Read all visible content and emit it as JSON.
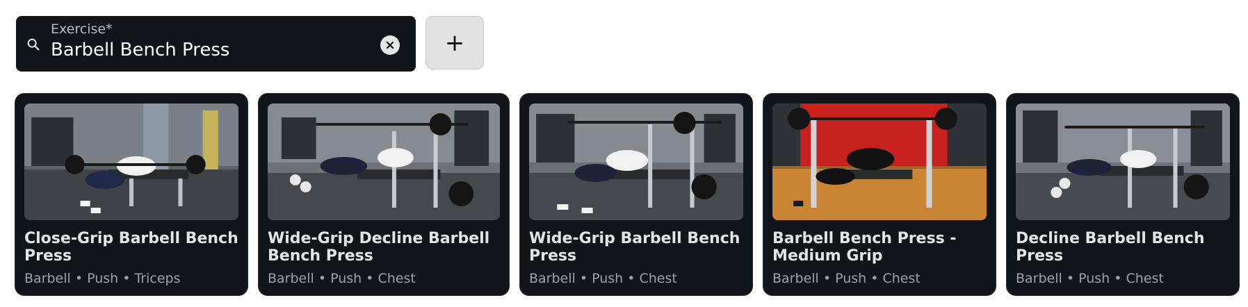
{
  "search": {
    "label": "Exercise*",
    "value": "Barbell Bench Press",
    "icon": "search-icon",
    "clear_icon": "clear-icon"
  },
  "add_button": {
    "label": "+"
  },
  "results": [
    {
      "title": "Close-Grip Barbell Bench Press",
      "meta": "Barbell • Push • Triceps",
      "image": "close-grip-bench-press-photo"
    },
    {
      "title": "Wide-Grip Decline Barbell Bench Press",
      "meta": "Barbell • Push • Chest",
      "image": "wide-grip-decline-bench-press-photo"
    },
    {
      "title": "Wide-Grip Barbell Bench Press",
      "meta": "Barbell • Push • Chest",
      "image": "wide-grip-bench-press-photo"
    },
    {
      "title": "Barbell Bench Press - Medium Grip",
      "meta": "Barbell • Push • Chest",
      "image": "medium-grip-bench-press-photo"
    },
    {
      "title": "Decline Barbell Bench Press",
      "meta": "Barbell • Push • Chest",
      "image": "decline-bench-press-photo"
    }
  ],
  "colors": {
    "field_bg": "#111418",
    "card_bg": "#111418",
    "title": "#e4e4e6",
    "meta": "#9ea2a8",
    "add_button_bg": "#e2e2e3",
    "red_wall": "#c8201c",
    "wood_floor": "#c98533"
  }
}
